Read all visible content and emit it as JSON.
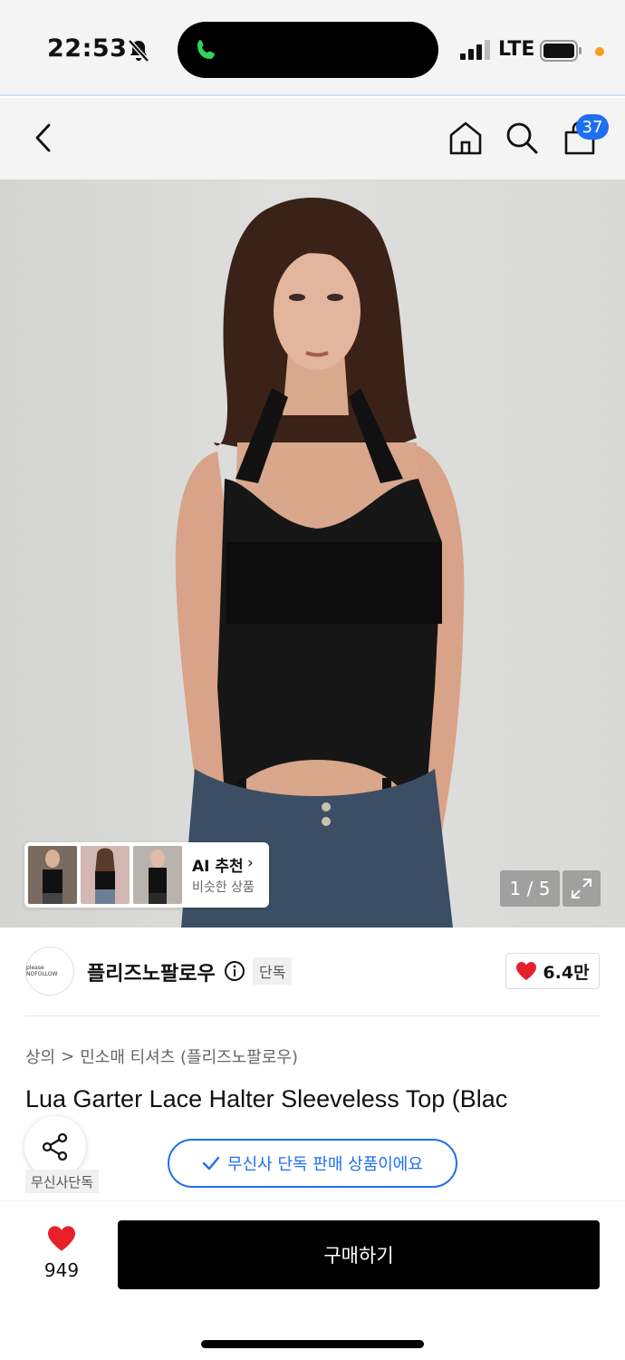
{
  "status_bar": {
    "time": "22:53",
    "network": "LTE"
  },
  "nav": {
    "cart_count": "37"
  },
  "gallery": {
    "counter": "1 / 5"
  },
  "ai_recommend": {
    "title": "AI 추천",
    "subtitle": "비슷한 상품"
  },
  "brand": {
    "logo_text": "please NOFOLLOW",
    "name": "플리즈노팔로우",
    "exclusive_tag": "단독",
    "likes": "6.4만"
  },
  "breadcrumb": {
    "level1": "상의",
    "separator": ">",
    "level2": "민소매 티셔츠 (플리즈노팔로우)"
  },
  "product": {
    "title": "Lua Garter Lace Halter Sleeveless Top (Blac",
    "store_tag": "무신사단독",
    "notice": "무신사 단독 판매 상품이에요"
  },
  "bottom": {
    "wish_count": "949",
    "buy_label": "구매하기"
  },
  "colors": {
    "accent_blue": "#1e6ff2",
    "heart_red": "#e8202a",
    "buy_black": "#000000"
  }
}
